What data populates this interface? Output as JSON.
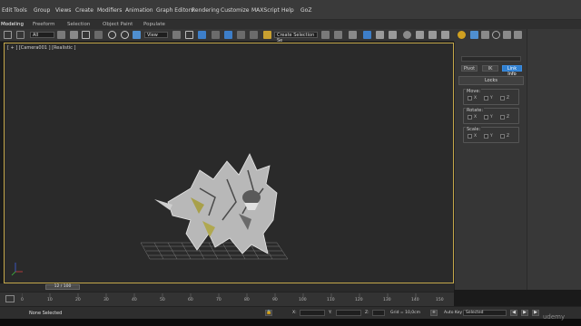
{
  "menu": [
    "Edit",
    "Tools",
    "Group",
    "Views",
    "Create",
    "Modifiers",
    "Animation",
    "Graph Editors",
    "Rendering",
    "Customize",
    "MAXScript",
    "Help",
    "GoZ"
  ],
  "ribbon_tabs": [
    "Modeling",
    "Freeform",
    "Selection",
    "Object Paint",
    "Populate"
  ],
  "toolbar": {
    "filter_value": "All",
    "view_value": "View",
    "selection_set_value": "Create Selection Se"
  },
  "viewport": {
    "label": "[ + ] [Camera001 ] [Realistic ]"
  },
  "command_panel": {
    "pivot_button": "Pivot",
    "ik_button": "IK",
    "link_info_button": "Link Info",
    "rollout_title": "Locks",
    "groups": [
      {
        "title": "Move:",
        "axes": [
          "X",
          "Y",
          "Z"
        ]
      },
      {
        "title": "Rotate:",
        "axes": [
          "X",
          "Y",
          "Z"
        ]
      },
      {
        "title": "Scale:",
        "axes": [
          "X",
          "Y",
          "Z"
        ]
      }
    ]
  },
  "timeline": {
    "slider_label": "12 / 100",
    "ticks": [
      "0",
      "10",
      "20",
      "30",
      "40",
      "50",
      "60",
      "70",
      "80",
      "90",
      "100",
      "110",
      "120",
      "130",
      "140",
      "150"
    ]
  },
  "status": {
    "selection_text": "None Selected",
    "x_label": "X:",
    "y_label": "Y:",
    "z_label": "Z:",
    "grid_text": "Grid = 10,0cm",
    "autokey_label": "Auto Key",
    "autokey_value": "Selected"
  },
  "watermark": "udemy"
}
